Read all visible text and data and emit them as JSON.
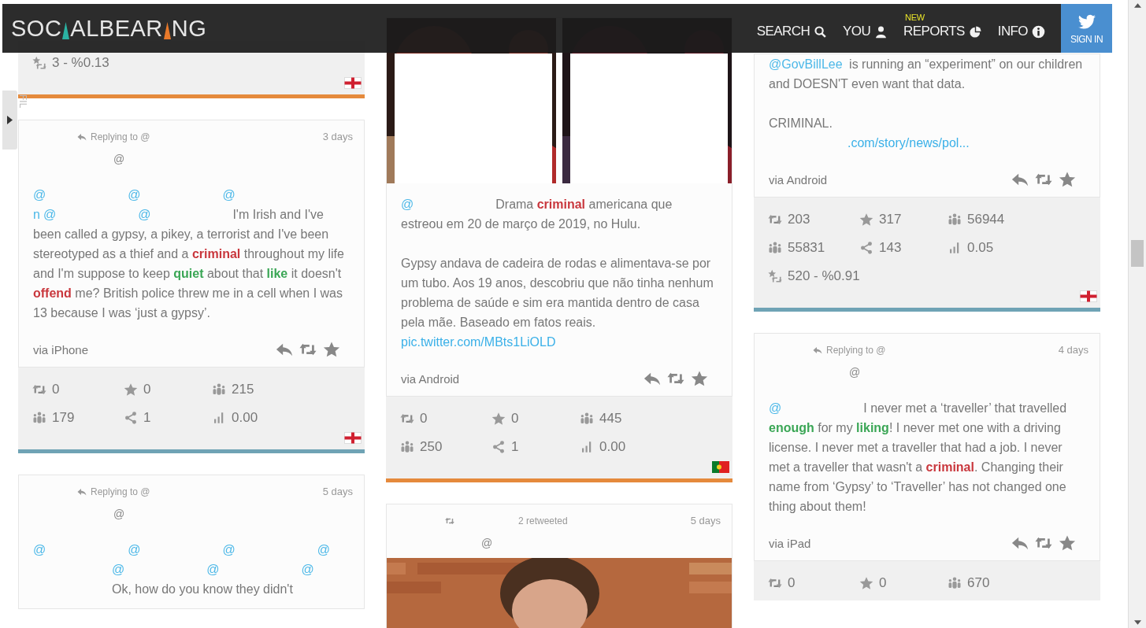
{
  "header": {
    "logo": [
      "SOC",
      "ALBEAR",
      "NG"
    ],
    "nav": [
      {
        "label": "SEARCH"
      },
      {
        "label": "YOU"
      },
      {
        "label": "REPORTS",
        "badge": "NEW"
      },
      {
        "label": "INFO"
      }
    ],
    "sign_in": "SIGN IN"
  },
  "side_panel": {
    "label": "FIL",
    "expanded": false
  },
  "columns": [
    {
      "cards": [
        {
          "reach": "3 - %0.13",
          "flag": {
            "kind": "england"
          },
          "color": "#e58a3c"
        },
        {
          "header": {
            "kind": "reply",
            "label": "Replying to @",
            "handle": "@",
            "time": "3 days"
          },
          "body": [
            [
              {
                "kind": "mention",
                "text": "@"
              },
              {
                "kind": "redacted"
              },
              {
                "kind": "mention",
                "text": "@"
              },
              {
                "kind": "redacted"
              },
              {
                "kind": "mention",
                "text": "@"
              },
              {
                "kind": "break"
              },
              {
                "kind": "mention",
                "text": "n"
              },
              {
                "kind": "mention",
                "text": "@"
              },
              {
                "kind": "redacted"
              },
              {
                "kind": "mention",
                "text": "@"
              },
              {
                "kind": "redacted"
              },
              {
                "kind": "text",
                "text": "I'm Irish and I've been called a gypsy, a pikey, a terrorist and I've been stereotyped as a thief and a "
              },
              {
                "kind": "negative",
                "text": "criminal"
              },
              {
                "kind": "text",
                "text": " throughout my life and I'm suppose to keep "
              },
              {
                "kind": "positive",
                "text": "quiet"
              },
              {
                "kind": "text",
                "text": " about that "
              },
              {
                "kind": "positive",
                "text": "like"
              },
              {
                "kind": "text",
                "text": " it doesn't "
              },
              {
                "kind": "negative",
                "text": "offend"
              },
              {
                "kind": "text",
                "text": " me? British police threw me in a cell when I was 13 because I was ‘just a gypsy’."
              }
            ]
          ],
          "source": "via iPhone",
          "stats": [
            {
              "kind": "retweets",
              "value": "0"
            },
            {
              "kind": "likes",
              "value": "0"
            },
            {
              "kind": "followers",
              "value": "215"
            },
            {
              "kind": "following",
              "value": "179"
            },
            {
              "kind": "shares",
              "value": "1"
            },
            {
              "kind": "ratio",
              "value": "0.00"
            }
          ],
          "flag": {
            "kind": "england"
          },
          "color": "#6fa3b5"
        },
        {
          "header": {
            "kind": "reply",
            "label": "Replying to @",
            "handle": "@",
            "time": "5 days"
          },
          "body": [
            [
              {
                "kind": "mention",
                "text": "@"
              },
              {
                "kind": "redacted"
              },
              {
                "kind": "mention",
                "text": "@"
              },
              {
                "kind": "redacted"
              },
              {
                "kind": "mention",
                "text": "@"
              },
              {
                "kind": "redacted"
              },
              {
                "kind": "mention",
                "text": "@"
              },
              {
                "kind": "break"
              },
              {
                "kind": "redacted"
              },
              {
                "kind": "mention",
                "text": "@"
              },
              {
                "kind": "redacted"
              },
              {
                "kind": "mention",
                "text": "@"
              },
              {
                "kind": "redacted"
              },
              {
                "kind": "mention",
                "text": "@"
              },
              {
                "kind": "break"
              },
              {
                "kind": "redacted"
              },
              {
                "kind": "text",
                "text": "Ok, how do you know they didn't"
              }
            ]
          ]
        }
      ]
    },
    {
      "cards": [
        {
          "media": [
            {
              "kind": "picture"
            },
            {
              "kind": "picture"
            }
          ],
          "body": [
            [
              {
                "kind": "mention",
                "text": "@"
              },
              {
                "kind": "redacted"
              },
              {
                "kind": "text",
                "text": "Drama "
              },
              {
                "kind": "negative",
                "text": "criminal"
              },
              {
                "kind": "text",
                "text": " americana que estreou em 20 de março de 2019, no Hulu."
              }
            ],
            [
              {
                "kind": "text",
                "text": "Gypsy andava de cadeira de rodas e alimentava-se por um tubo. Aos 19 anos, descobriu que não tinha nenhum problema de saúde e sim era mantida dentro de casa pela mãe. Baseado em fatos reais. "
              },
              {
                "kind": "link",
                "text": "pic.twitter.com/MBts1LiOLD"
              }
            ]
          ],
          "source": "via Android",
          "stats": [
            {
              "kind": "retweets",
              "value": "0"
            },
            {
              "kind": "likes",
              "value": "0"
            },
            {
              "kind": "followers",
              "value": "445"
            },
            {
              "kind": "following",
              "value": "250"
            },
            {
              "kind": "shares",
              "value": "1"
            },
            {
              "kind": "ratio",
              "value": "0.00"
            }
          ],
          "flag": {
            "kind": "portugal"
          },
          "color": "#e58a3c"
        },
        {
          "header": {
            "kind": "retweet",
            "label": "2 retweeted",
            "handle": "@",
            "time": "5 days"
          },
          "media": [
            {
              "kind": "picture"
            }
          ]
        }
      ]
    },
    {
      "cards": [
        {
          "body": [
            [
              {
                "kind": "mention",
                "text": "@GovBillLee"
              },
              {
                "kind": "text",
                "text": " is running an “experiment” on our children and DOESN'T even want that data."
              }
            ],
            [
              {
                "kind": "text",
                "text": "CRIMINAL."
              },
              {
                "kind": "break"
              },
              {
                "kind": "redacted"
              },
              {
                "kind": "link",
                "text": ".com/story/news/pol..."
              }
            ]
          ],
          "source": "via Android",
          "stats": [
            {
              "kind": "retweets",
              "value": "203"
            },
            {
              "kind": "likes",
              "value": "317"
            },
            {
              "kind": "followers",
              "value": "56944"
            },
            {
              "kind": "following",
              "value": "55831"
            },
            {
              "kind": "shares",
              "value": "143"
            },
            {
              "kind": "ratio",
              "value": "0.05"
            }
          ],
          "reach": "520 - %0.91",
          "flag": {
            "kind": "england"
          },
          "color": "#6fa3b5"
        },
        {
          "header": {
            "kind": "reply",
            "label": "Replying to @",
            "handle": "@",
            "time": "4 days"
          },
          "body": [
            [
              {
                "kind": "mention",
                "text": "@"
              },
              {
                "kind": "redacted"
              },
              {
                "kind": "text",
                "text": "I never met a ‘traveller’ that travelled "
              },
              {
                "kind": "positive",
                "text": "enough"
              },
              {
                "kind": "text",
                "text": " for my "
              },
              {
                "kind": "positive",
                "text": "liking"
              },
              {
                "kind": "text",
                "text": "! I never met one with a driving license. I never met a traveller that had a job. I never met a traveller that wasn't a "
              },
              {
                "kind": "negative",
                "text": "criminal"
              },
              {
                "kind": "text",
                "text": ". Changing their name from ‘Gypsy’ to ‘Traveller’ has not changed one thing about them!"
              }
            ]
          ],
          "source": "via iPad",
          "stats": [
            {
              "kind": "retweets",
              "value": "0"
            },
            {
              "kind": "likes",
              "value": "0"
            },
            {
              "kind": "followers",
              "value": "670"
            }
          ]
        }
      ]
    }
  ]
}
